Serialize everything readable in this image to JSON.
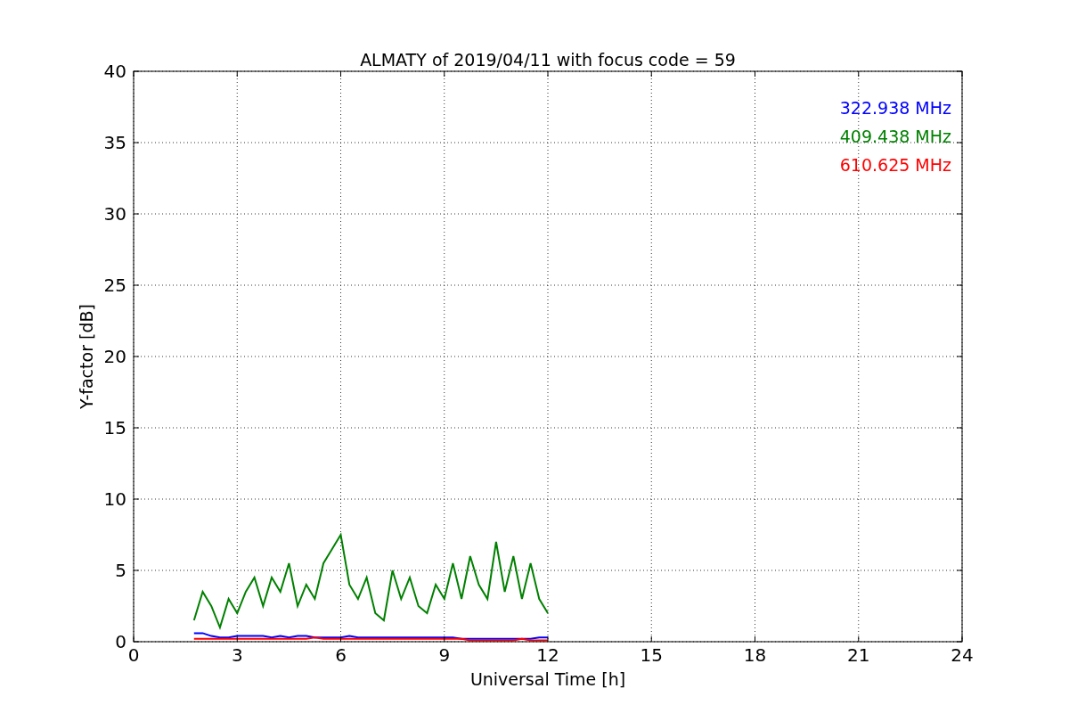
{
  "chart_data": {
    "type": "line",
    "title": "ALMATY of 2019/04/11 with focus code = 59",
    "xlabel": "Universal Time [h]",
    "ylabel": "Y-factor [dB]",
    "x": [
      1.75,
      2.0,
      2.25,
      2.5,
      2.75,
      3.0,
      3.25,
      3.5,
      3.75,
      4.0,
      4.25,
      4.5,
      4.75,
      5.0,
      5.25,
      5.5,
      5.75,
      6.0,
      6.25,
      6.5,
      6.75,
      7.0,
      7.25,
      7.5,
      7.75,
      8.0,
      8.25,
      8.5,
      8.75,
      9.0,
      9.25,
      9.5,
      9.75,
      10.0,
      10.25,
      10.5,
      10.75,
      11.0,
      11.25,
      11.5,
      11.75,
      12.0
    ],
    "series": [
      {
        "name": "322.938 MHz",
        "color": "#0000ff",
        "values": [
          0.6,
          0.6,
          0.4,
          0.3,
          0.3,
          0.4,
          0.4,
          0.4,
          0.4,
          0.3,
          0.4,
          0.3,
          0.4,
          0.4,
          0.3,
          0.3,
          0.3,
          0.3,
          0.4,
          0.3,
          0.3,
          0.3,
          0.3,
          0.3,
          0.3,
          0.3,
          0.3,
          0.3,
          0.3,
          0.3,
          0.3,
          0.2,
          0.2,
          0.2,
          0.2,
          0.2,
          0.2,
          0.2,
          0.2,
          0.2,
          0.3,
          0.3
        ]
      },
      {
        "name": "409.438 MHz",
        "color": "#008000",
        "values": [
          1.5,
          3.5,
          2.5,
          1.0,
          3.0,
          2.0,
          3.5,
          4.5,
          2.5,
          4.5,
          3.5,
          5.5,
          2.5,
          4.0,
          3.0,
          5.5,
          6.5,
          7.5,
          4.0,
          3.0,
          4.5,
          2.0,
          1.5,
          5.0,
          3.0,
          4.5,
          2.5,
          2.0,
          4.0,
          3.0,
          5.5,
          3.0,
          6.0,
          4.0,
          3.0,
          7.0,
          3.5,
          6.0,
          3.0,
          5.5,
          3.0,
          2.0
        ]
      },
      {
        "name": "610.625 MHz",
        "color": "#ff0000",
        "values": [
          0.2,
          0.2,
          0.2,
          0.2,
          0.2,
          0.2,
          0.2,
          0.2,
          0.2,
          0.2,
          0.2,
          0.2,
          0.2,
          0.2,
          0.3,
          0.2,
          0.2,
          0.2,
          0.2,
          0.2,
          0.2,
          0.2,
          0.2,
          0.2,
          0.2,
          0.2,
          0.2,
          0.2,
          0.2,
          0.2,
          0.2,
          0.2,
          0.1,
          0.1,
          0.1,
          0.1,
          0.1,
          0.1,
          0.2,
          0.1,
          0.1,
          0.1
        ]
      }
    ],
    "xlim": [
      0,
      24
    ],
    "ylim": [
      0,
      40
    ],
    "xticks": [
      0,
      3,
      6,
      9,
      12,
      15,
      18,
      21,
      24
    ],
    "yticks": [
      0,
      5,
      10,
      15,
      20,
      25,
      30,
      35,
      40
    ],
    "grid": true
  }
}
